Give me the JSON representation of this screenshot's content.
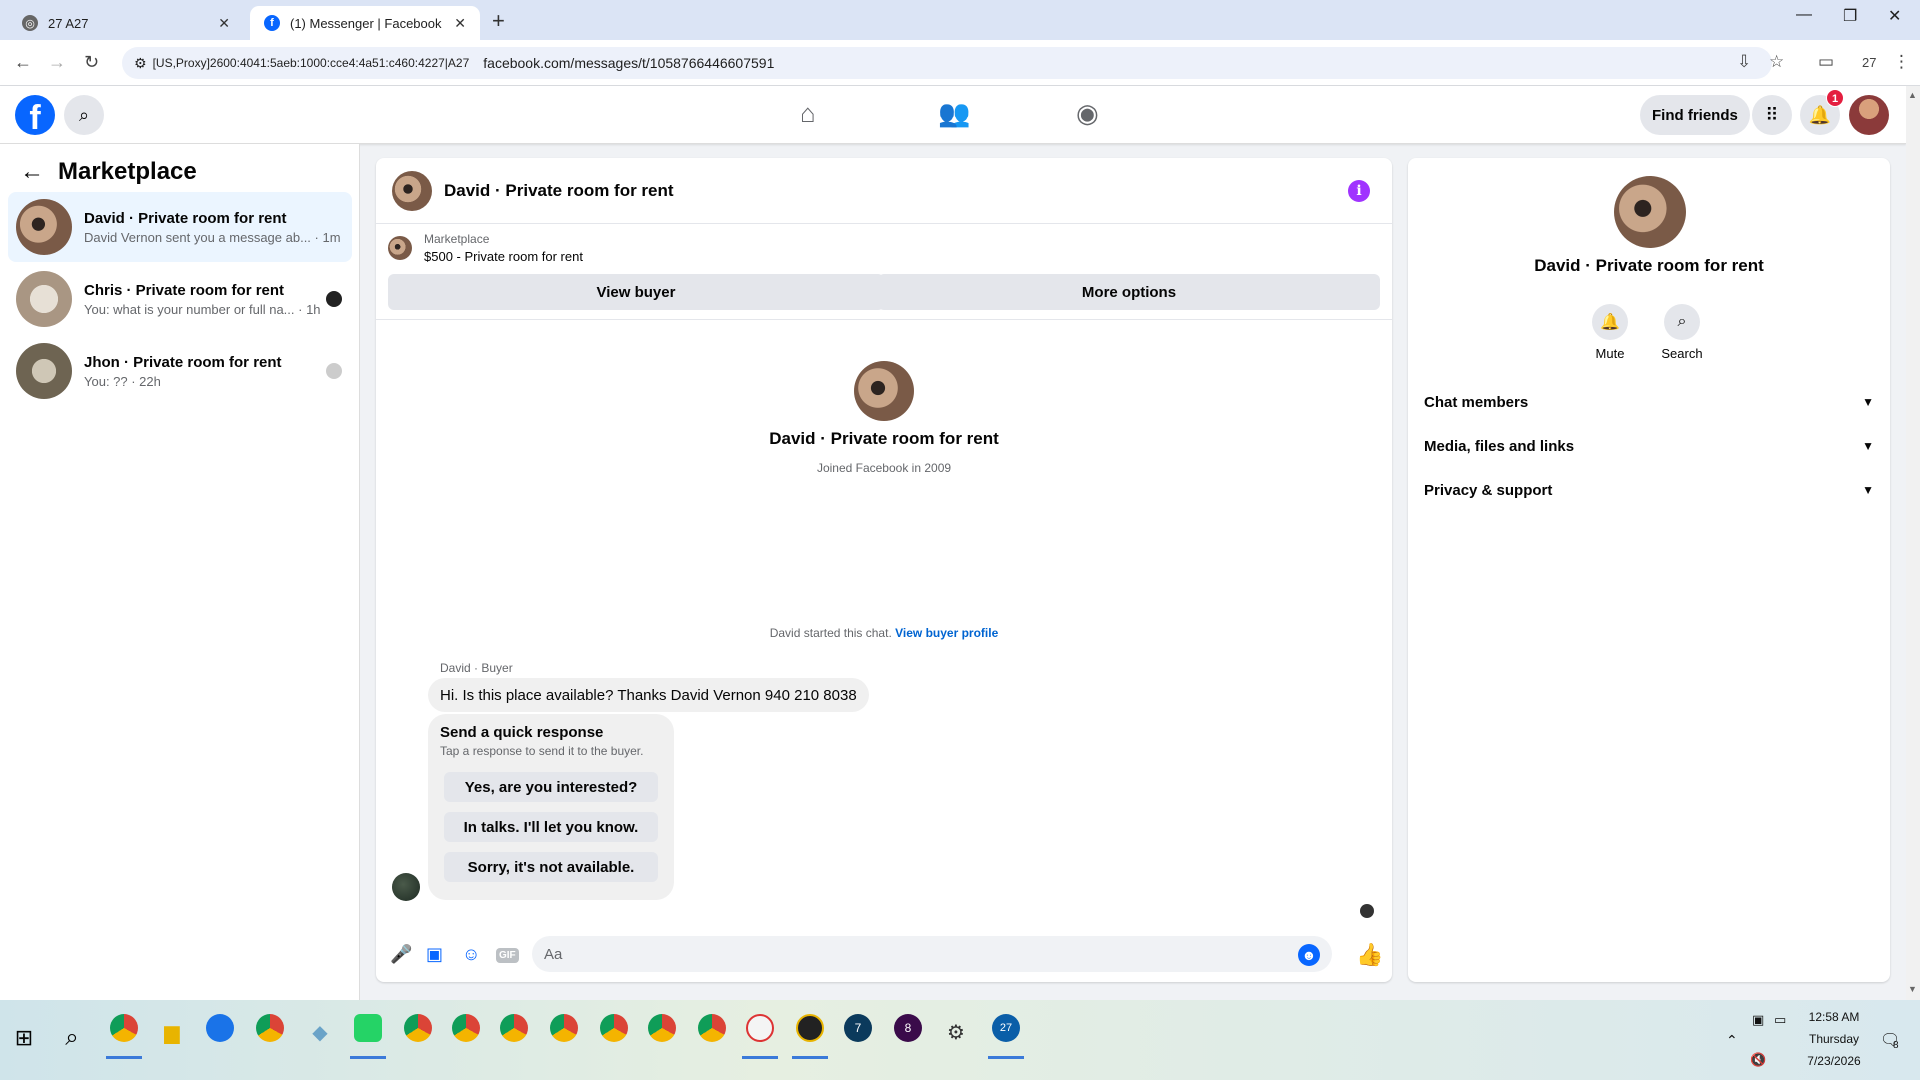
{
  "browser": {
    "tabs": [
      {
        "title": "27 A27",
        "active": false
      },
      {
        "title": "(1) Messenger | Facebook",
        "active": true
      }
    ],
    "proxy_label": "[US,Proxy]2600:4041:5aeb:1000:cce4:4a51:c460:4227|A27",
    "url": "facebook.com/messages/t/1058766446607591",
    "profile_count": "27"
  },
  "header": {
    "find_friends": "Find friends",
    "notification_count": "1"
  },
  "sidebar": {
    "title": "Marketplace",
    "conversations": [
      {
        "name": "David · Private room for rent",
        "snippet": "David Vernon sent you a message ab... · 1m",
        "selected": true
      },
      {
        "name": "Chris · Private room for rent",
        "snippet": "You: what is your number or full na... · 1h",
        "selected": false
      },
      {
        "name": "Jhon · Private room for rent",
        "snippet": "You: ?? · 22h",
        "selected": false
      }
    ]
  },
  "chat": {
    "title": "David · Private room for rent",
    "listing_source": "Marketplace",
    "listing_price": "$500 - Private room for rent",
    "view_buyer": "View buyer",
    "more_options": "More options",
    "intro_name": "David · Private room for rent",
    "intro_sub": "Joined Facebook in 2009",
    "started_text": "David started this chat.",
    "started_link": "View buyer profile",
    "sender_label": "David · Buyer",
    "message": "Hi.  Is this place available? Thanks David Vernon 940 210 8038",
    "quick_title": "Send a quick response",
    "quick_sub": "Tap a response to send it to the buyer.",
    "quick_responses": [
      "Yes, are you interested?",
      "In talks. I'll let you know.",
      "Sorry, it's not available."
    ],
    "input_placeholder": "Aa",
    "gif_label": "GIF"
  },
  "details": {
    "name": "David · Private room for rent",
    "mute": "Mute",
    "search": "Search",
    "sections": [
      "Chat members",
      "Media, files and links",
      "Privacy & support"
    ]
  },
  "taskbar": {
    "time": "12:58 AM",
    "day": "Thursday",
    "date": "7/23/2026",
    "notif_count": "8",
    "badges": [
      "7",
      "8",
      "27"
    ]
  },
  "colors": {
    "fb_blue": "#0866ff",
    "info_purple": "#a033ff",
    "notification_red": "#e41e3f",
    "selected_bg": "#ebf5ff"
  }
}
